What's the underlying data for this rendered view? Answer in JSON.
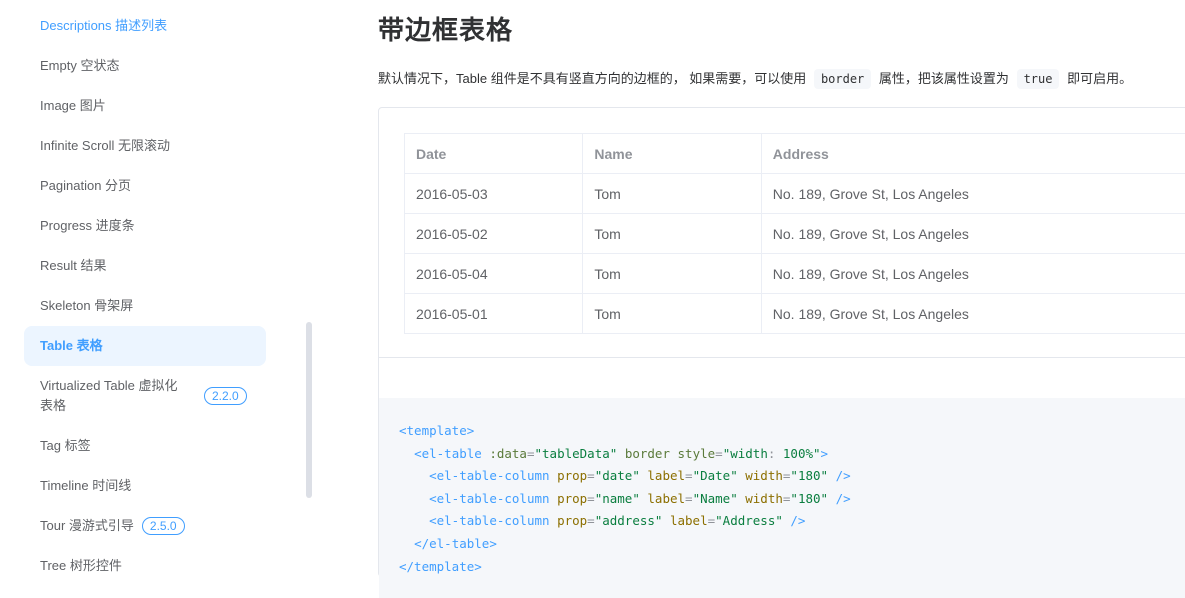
{
  "sidebar": {
    "items": [
      {
        "label": "Descriptions 描述列表"
      },
      {
        "label": "Empty 空状态"
      },
      {
        "label": "Image 图片"
      },
      {
        "label": "Infinite Scroll 无限滚动"
      },
      {
        "label": "Pagination 分页"
      },
      {
        "label": "Progress 进度条"
      },
      {
        "label": "Result 结果"
      },
      {
        "label": "Skeleton 骨架屏"
      },
      {
        "label": "Table 表格"
      },
      {
        "label": "Virtualized Table 虚拟化表格",
        "badge": "2.2.0"
      },
      {
        "label": "Tag 标签"
      },
      {
        "label": "Timeline 时间线"
      },
      {
        "label": "Tour 漫游式引导",
        "badge": "2.5.0"
      },
      {
        "label": "Tree 树形控件"
      }
    ]
  },
  "main": {
    "title": "带边框表格",
    "desc_prefix": "默认情况下，Table 组件是不具有竖直方向的边框的， 如果需要，可以使用",
    "desc_code1": "border",
    "desc_mid": "属性，把该属性设置为",
    "desc_code2": "true",
    "desc_suffix": "即可启用。"
  },
  "table": {
    "headers": [
      "Date",
      "Name",
      "Address"
    ],
    "rows": [
      [
        "2016-05-03",
        "Tom",
        "No. 189, Grove St, Los Angeles"
      ],
      [
        "2016-05-02",
        "Tom",
        "No. 189, Grove St, Los Angeles"
      ],
      [
        "2016-05-04",
        "Tom",
        "No. 189, Grove St, Los Angeles"
      ],
      [
        "2016-05-01",
        "Tom",
        "No. 189, Grove St, Los Angeles"
      ]
    ]
  },
  "code": {
    "l1": "<template>",
    "l2_tag": "<el-table",
    "l2_a1": ":data",
    "l2_v1": "\"tableData\"",
    "l2_a2": "border",
    "l2_a3": "style",
    "l2_v3a": "\"width",
    "l2_v3b": ": ",
    "l2_v3c": "100%",
    "l2_v3d": "\"",
    "l2_end": ">",
    "col_tag": "<el-table-column",
    "prop": "prop",
    "label": "label",
    "width": "width",
    "c1_prop": "\"date\"",
    "c1_label": "\"Date\"",
    "c1_width": "\"180\"",
    "c2_prop": "\"name\"",
    "c2_label": "\"Name\"",
    "c2_width": "\"180\"",
    "c3_prop": "\"address\"",
    "c3_label": "\"Address\"",
    "self_close": "/>",
    "l6": "</el-table>",
    "l7": "</template>"
  }
}
